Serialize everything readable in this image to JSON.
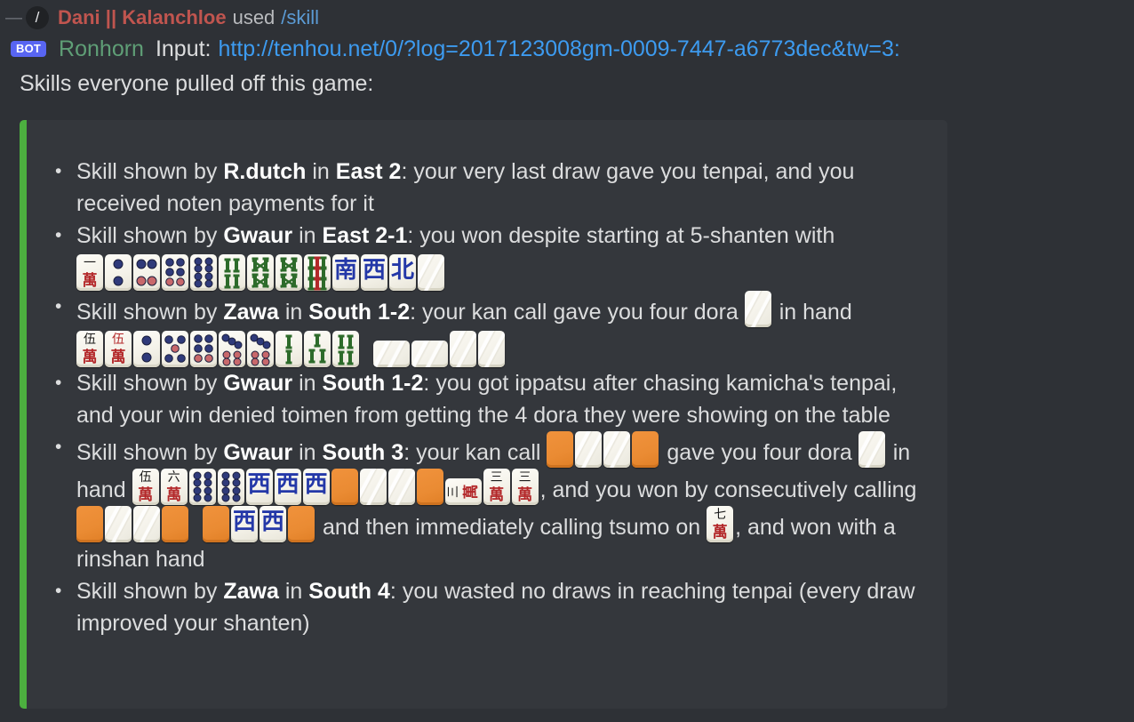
{
  "header": {
    "thread_dash": "—",
    "avatar_glyph": "/",
    "command_user": "Dani || Kalanchloe",
    "used_text": "used",
    "command_name": "/skill",
    "bot_badge": "BOT",
    "bot_name": "Ronhorn",
    "input_label": "Input:",
    "input_url": "http://tenhou.net/0/?log=2017123008gm-0009-7447-a6773dec&tw=3:",
    "intro_text": "Skills everyone pulled off this game:"
  },
  "colors": {
    "page_background": "#2e3136",
    "embed_background": "#34373c",
    "embed_accent_bar": "#4caf3f",
    "username_red": "#c0554f",
    "bot_name_green": "#5f9e76",
    "link_blue": "#3d9bf0",
    "command_blue": "#5b9bd5",
    "bot_badge_blurple": "#5865f2",
    "body_text": "#dcddde",
    "tile_face": "#f6f4ec",
    "tile_orange": "#ea8b33",
    "man_red": "#b3282a",
    "pin_blue": "#2f3a7a",
    "sou_green": "#2d6b2a",
    "honor_blue": "#2438a8"
  },
  "skills": [
    {
      "prefix": "Skill shown by ",
      "player": "R.dutch",
      "mid": " in ",
      "round": "East 2",
      "text": ": your very last draw gave you tenpai, and you received noten payments for it",
      "tiles": []
    },
    {
      "prefix": "Skill shown by ",
      "player": "Gwaur",
      "mid": " in ",
      "round": "East 2-1",
      "text": ": you won despite starting at 5-shanten with",
      "tiles": [
        "1m",
        "2p",
        "4p",
        "6p",
        "8p",
        "4s",
        "6s",
        "6s",
        "9s",
        "S",
        "W",
        "N",
        "back"
      ]
    },
    {
      "prefix": "Skill shown by ",
      "player": "Zawa",
      "mid": " in ",
      "round": "South 1-2",
      "text": ": your kan call gave you four dora",
      "text2": "in hand",
      "inline_tile": "back",
      "tiles": [
        "5m",
        "0m",
        "2p",
        "5p",
        "6p",
        "7p",
        "7p",
        "2s",
        "3s",
        "4s",
        "gap",
        "back-rot",
        "back-rot",
        "back",
        "back"
      ]
    },
    {
      "prefix": "Skill shown by ",
      "player": "Gwaur",
      "mid": " in ",
      "round": "South 1-2",
      "text": ": you got ippatsu after chasing kamicha's tenpai, and your win denied toimen from getting the 4 dora they were showing on the table",
      "tiles": []
    },
    {
      "prefix": "Skill shown by ",
      "player": "Gwaur",
      "mid": " in ",
      "round": "South 3",
      "seg1": ": your kan call",
      "kan1": [
        "orange",
        "back",
        "back",
        "orange"
      ],
      "seg2": "gave you four dora",
      "dora_tile": "back",
      "seg3": "in hand",
      "hand": [
        "5m",
        "6m",
        "8p",
        "8p",
        "W",
        "W",
        "W",
        "orange",
        "back",
        "back",
        "orange",
        "3m-rot",
        "3m",
        "3m"
      ],
      "seg4": ", and you won by consecutively calling",
      "call2": [
        "orange",
        "back",
        "back",
        "orange",
        "gap",
        "orange",
        "W",
        "W",
        "orange"
      ],
      "seg5": "and then immediately calling tsumo on",
      "tsumo_tile": "7m",
      "seg6": ", and won with a rinshan hand"
    },
    {
      "prefix": "Skill shown by ",
      "player": "Zawa",
      "mid": " in ",
      "round": "South 4",
      "text": ": you wasted no draws in reaching tenpai (every draw improved your shanten)",
      "tiles": []
    }
  ]
}
